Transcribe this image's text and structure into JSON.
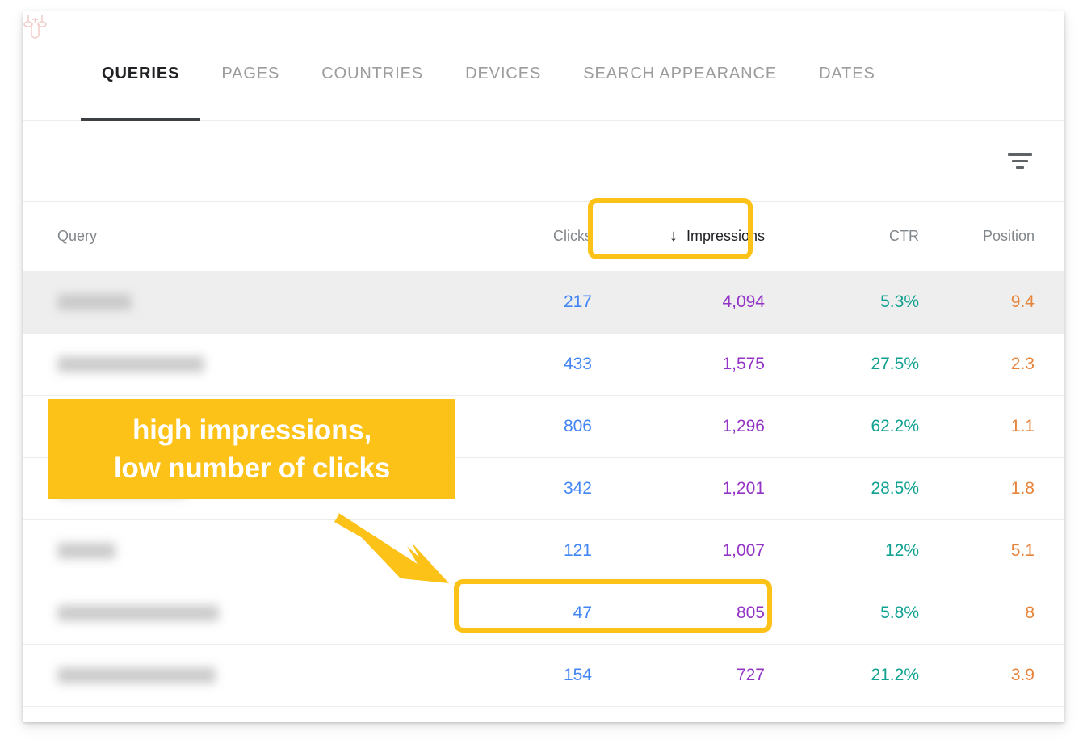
{
  "tabs": [
    {
      "label": "QUERIES",
      "active": true
    },
    {
      "label": "PAGES",
      "active": false
    },
    {
      "label": "COUNTRIES",
      "active": false
    },
    {
      "label": "DEVICES",
      "active": false
    },
    {
      "label": "SEARCH APPEARANCE",
      "active": false
    },
    {
      "label": "DATES",
      "active": false
    }
  ],
  "toolbar": {
    "filter_icon": "filter-icon"
  },
  "table": {
    "columns": {
      "query": "Query",
      "clicks": "Clicks",
      "impressions": "Impressions",
      "ctr": "CTR",
      "position": "Position"
    },
    "sort": {
      "column": "Impressions",
      "direction": "descending",
      "arrow_glyph": "↓"
    },
    "rows": [
      {
        "query": "",
        "clicks": "217",
        "impressions": "4,094",
        "ctr": "5.3%",
        "position": "9.4",
        "shaded": true
      },
      {
        "query": "",
        "clicks": "433",
        "impressions": "1,575",
        "ctr": "27.5%",
        "position": "2.3",
        "shaded": false
      },
      {
        "query": "",
        "clicks": "806",
        "impressions": "1,296",
        "ctr": "62.2%",
        "position": "1.1",
        "shaded": false
      },
      {
        "query": "",
        "clicks": "342",
        "impressions": "1,201",
        "ctr": "28.5%",
        "position": "1.8",
        "shaded": false
      },
      {
        "query": "",
        "clicks": "121",
        "impressions": "1,007",
        "ctr": "12%",
        "position": "5.1",
        "shaded": false
      },
      {
        "query": "",
        "clicks": "47",
        "impressions": "805",
        "ctr": "5.8%",
        "position": "8",
        "shaded": false
      },
      {
        "query": "",
        "clicks": "154",
        "impressions": "727",
        "ctr": "21.2%",
        "position": "3.9",
        "shaded": false
      }
    ]
  },
  "annotations": {
    "callout_line1": "high impressions,",
    "callout_line2": "low number of clicks",
    "highlight_color": "#fcc217",
    "arrow": "down-right-arrow"
  },
  "colors": {
    "clicks": "#4285f4",
    "impressions": "#9334c6",
    "ctr": "#10a191",
    "position": "#e8833a",
    "accent": "#fcc217",
    "shaded_row": "#eeeeee"
  }
}
